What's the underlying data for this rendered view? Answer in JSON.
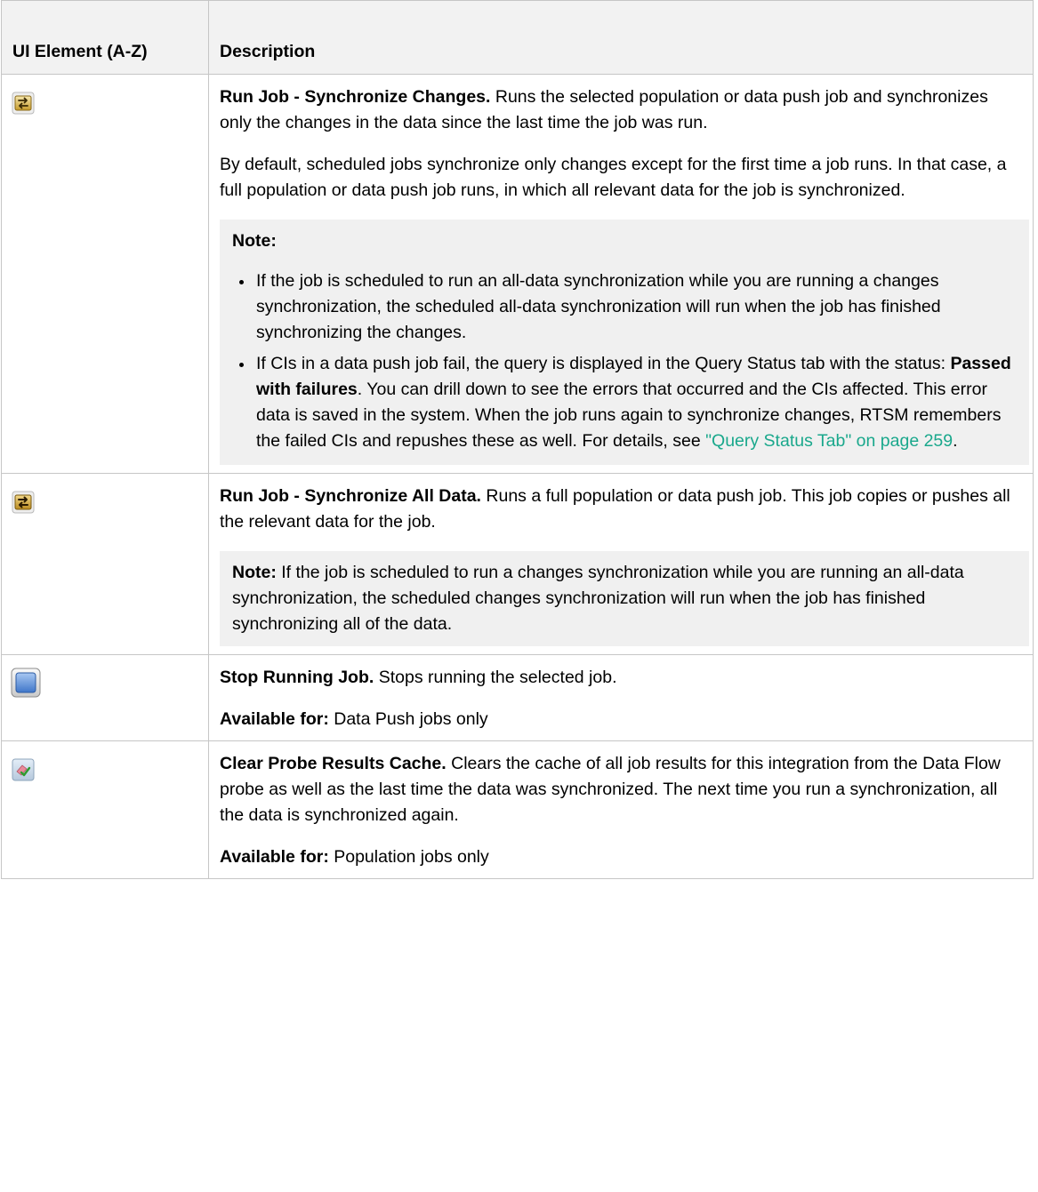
{
  "table": {
    "header": {
      "col1": "UI Element (A-Z)",
      "col2": "Description"
    },
    "rows": [
      {
        "icon": "sync-changes-icon",
        "title": "Run Job - Synchronize Changes.",
        "text": " Runs the selected population or data push job and synchronizes only the changes in the data since the last time the job was run.",
        "para2": "By default, scheduled jobs synchronize only changes except for the first time a job runs. In that case, a full population or data push job runs, in which all relevant data for the job is synchronized.",
        "note": {
          "label": "Note:",
          "bullet1": "If the job is scheduled to run an all-data synchronization while you are running a changes synchronization, the scheduled all-data synchronization will run when the job has finished synchronizing the changes.",
          "bullet2_pre": "If CIs in a data push job fail, the query is displayed in the Query Status tab with the status: ",
          "bullet2_bold": "Passed with failures",
          "bullet2_post": ". You can drill down to see the errors that occurred and the CIs affected. This error data is saved in the system. When the job runs again to synchronize changes, RTSM remembers the failed CIs and repushes these as well. For details, see ",
          "bullet2_link": "\"Query Status Tab\" on page 259",
          "bullet2_end": "."
        }
      },
      {
        "icon": "sync-all-icon",
        "title": "Run Job - Synchronize All Data.",
        "text": " Runs a full population or data push job. This job copies or pushes all the relevant data for the job.",
        "note": {
          "label": "Note:",
          "text": " If the job is scheduled to run a changes synchronization while you are running an all-data synchronization, the scheduled changes synchronization will run when the job has finished synchronizing all of the data."
        }
      },
      {
        "icon": "stop-icon",
        "title": "Stop Running Job.",
        "text": " Stops running the selected job.",
        "avail_label": "Available for:",
        "avail_text": " Data Push jobs only"
      },
      {
        "icon": "clear-cache-icon",
        "title": "Clear Probe Results Cache.",
        "text": " Clears the cache of all job results for this integration from the Data Flow probe as well as the last time the data was synchronized. The next time you run a synchronization, all the data is synchronized again.",
        "avail_label": "Available for:",
        "avail_text": " Population jobs only"
      }
    ]
  },
  "colors": {
    "border": "#c6c6c6",
    "header_bg": "#f2f2f2",
    "note_bg": "#f0f0f0",
    "link": "#1aa88c",
    "sync_icon_gold": "#c9a23a",
    "stop_icon_blue": "#5b8fd8"
  }
}
